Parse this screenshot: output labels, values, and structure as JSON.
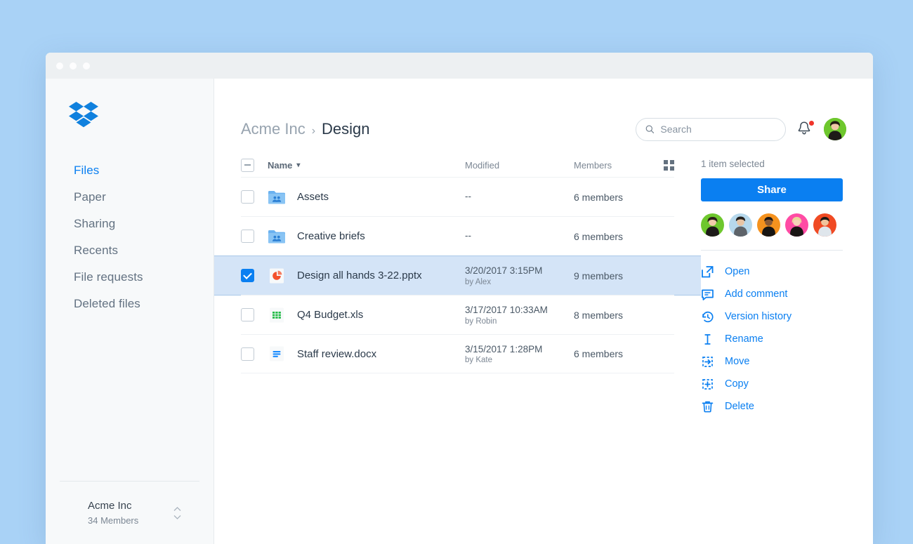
{
  "window": {
    "dots": [
      "close-dot",
      "minimize-dot",
      "maximize-dot"
    ]
  },
  "colors": {
    "accent": "#0a7ff1",
    "page_background": "#a9d2f6",
    "sidebar_background": "#f7f9fa",
    "selected_row": "#d4e4f7",
    "notification_dot": "#f0342a"
  },
  "sidebar": {
    "logo": "dropbox-logo",
    "items": [
      {
        "label": "Files",
        "active": true
      },
      {
        "label": "Paper",
        "active": false
      },
      {
        "label": "Sharing",
        "active": false
      },
      {
        "label": "Recents",
        "active": false
      },
      {
        "label": "File requests",
        "active": false
      },
      {
        "label": "Deleted files",
        "active": false
      }
    ],
    "team": {
      "name": "Acme Inc",
      "members": "34 Members"
    }
  },
  "header": {
    "breadcrumb": {
      "root": "Acme Inc",
      "separator": "›",
      "current": "Design"
    },
    "search": {
      "placeholder": "Search",
      "value": "",
      "icon": "search-icon"
    },
    "notifications": {
      "icon": "bell-icon",
      "has_unread": true
    },
    "avatar": "user-avatar"
  },
  "table": {
    "columns": {
      "name": "Name",
      "modified": "Modified",
      "members": "Members"
    },
    "sort_indicator": "▾",
    "select_all_state": "indeterminate",
    "view_toggle": "grid-view-icon",
    "rows": [
      {
        "name": "Assets",
        "icon": "shared-folder-icon",
        "modified": "--",
        "modified_by": "",
        "members": "6 members",
        "selected": false
      },
      {
        "name": "Creative briefs",
        "icon": "shared-folder-icon",
        "modified": "--",
        "modified_by": "",
        "members": "6 members",
        "selected": false
      },
      {
        "name": "Design all hands 3-22.pptx",
        "icon": "powerpoint-file-icon",
        "modified": "3/20/2017 3:15PM",
        "modified_by": "by Alex",
        "members": "9 members",
        "selected": true
      },
      {
        "name": "Q4 Budget.xls",
        "icon": "excel-file-icon",
        "modified": "3/17/2017 10:33AM",
        "modified_by": "by Robin",
        "members": "8 members",
        "selected": false
      },
      {
        "name": "Staff review.docx",
        "icon": "word-file-icon",
        "modified": "3/15/2017 1:28PM",
        "modified_by": "by Kate",
        "members": "6 members",
        "selected": false
      }
    ]
  },
  "panel": {
    "selection_status": "1 item selected",
    "share_label": "Share",
    "member_avatars": [
      {
        "name": "member-avatar-1",
        "color": "#6ec72d"
      },
      {
        "name": "member-avatar-2",
        "color": "#b6d8ec"
      },
      {
        "name": "member-avatar-3",
        "color": "#f5921e"
      },
      {
        "name": "member-avatar-4",
        "color": "#ff4ba4"
      },
      {
        "name": "member-avatar-5",
        "color": "#f04a23"
      }
    ],
    "actions": [
      {
        "label": "Open",
        "icon": "open-external-icon"
      },
      {
        "label": "Add comment",
        "icon": "comment-icon"
      },
      {
        "label": "Version history",
        "icon": "history-clock-icon"
      },
      {
        "label": "Rename",
        "icon": "text-cursor-icon"
      },
      {
        "label": "Move",
        "icon": "move-icon"
      },
      {
        "label": "Copy",
        "icon": "copy-icon"
      },
      {
        "label": "Delete",
        "icon": "trash-icon"
      }
    ]
  }
}
